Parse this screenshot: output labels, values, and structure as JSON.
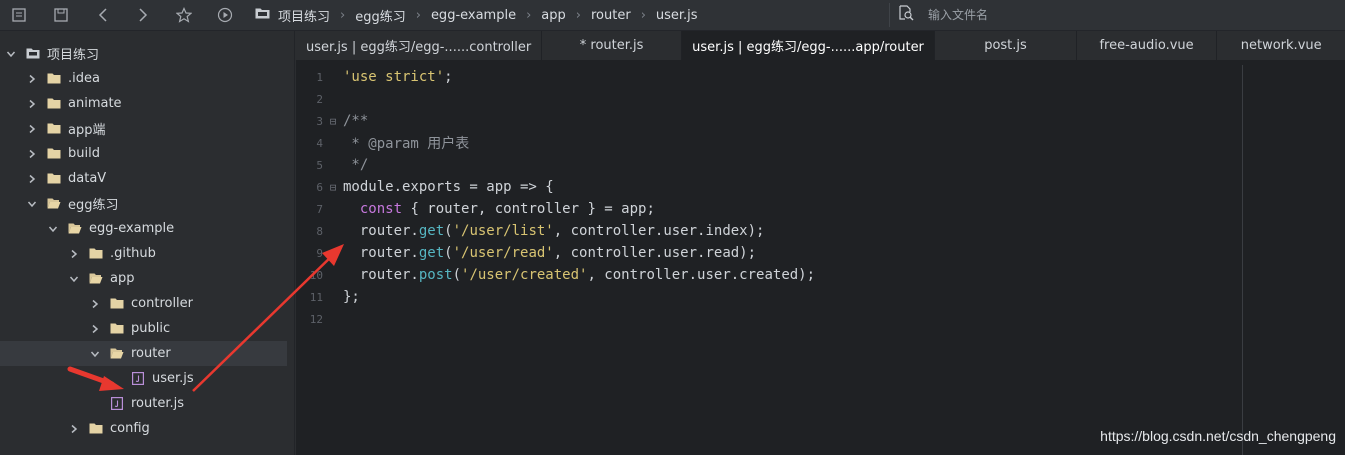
{
  "toolbar": {
    "icons": [
      "sidebar-toggle-icon",
      "save-icon",
      "back-icon",
      "forward-icon",
      "star-icon",
      "run-icon"
    ]
  },
  "breadcrumb": {
    "items": [
      "项目练习",
      "egg练习",
      "egg-example",
      "app",
      "router",
      "user.js"
    ]
  },
  "search": {
    "placeholder": "输入文件名"
  },
  "tree": {
    "items": [
      {
        "label": "项目练习",
        "type": "folder",
        "expanded": true
      },
      {
        "label": ".idea",
        "type": "folder",
        "expanded": false
      },
      {
        "label": "animate",
        "type": "folder",
        "expanded": false
      },
      {
        "label": "app端",
        "type": "folder",
        "expanded": false
      },
      {
        "label": "build",
        "type": "folder",
        "expanded": false
      },
      {
        "label": "dataV",
        "type": "folder",
        "expanded": false
      },
      {
        "label": "egg练习",
        "type": "folder",
        "expanded": true
      },
      {
        "label": "egg-example",
        "type": "folder",
        "expanded": true
      },
      {
        "label": ".github",
        "type": "folder",
        "expanded": false
      },
      {
        "label": "app",
        "type": "folder",
        "expanded": true
      },
      {
        "label": "controller",
        "type": "folder",
        "expanded": false
      },
      {
        "label": "public",
        "type": "folder",
        "expanded": false
      },
      {
        "label": "router",
        "type": "folder",
        "expanded": true
      },
      {
        "label": "user.js",
        "type": "file"
      },
      {
        "label": "router.js",
        "type": "file"
      },
      {
        "label": "config",
        "type": "folder",
        "expanded": false
      }
    ]
  },
  "tabs": [
    {
      "label": "user.js | egg练习/egg-......controller"
    },
    {
      "label": "* router.js"
    },
    {
      "label": "user.js | egg练习/egg-......app/router",
      "active": true
    },
    {
      "label": "post.js"
    },
    {
      "label": "free-audio.vue"
    },
    {
      "label": "network.vue"
    }
  ],
  "editor": {
    "lines": [
      {
        "n": "1",
        "t": [
          [
            "str",
            "'use strict'"
          ],
          [
            "def",
            ";"
          ]
        ]
      },
      {
        "n": "2",
        "t": []
      },
      {
        "n": "3",
        "fold": "⊟",
        "t": [
          [
            "cm",
            "/**"
          ]
        ]
      },
      {
        "n": "4",
        "t": [
          [
            "cm",
            " * @param 用户表"
          ]
        ]
      },
      {
        "n": "5",
        "t": [
          [
            "cm",
            " */"
          ]
        ]
      },
      {
        "n": "6",
        "fold": "⊟",
        "t": [
          [
            "def",
            "module.exports = app => {"
          ]
        ]
      },
      {
        "n": "7",
        "t": [
          [
            "def",
            "  "
          ],
          [
            "kw",
            "const"
          ],
          [
            "def",
            " { router, controller } = app;"
          ]
        ]
      },
      {
        "n": "8",
        "t": [
          [
            "def",
            "  router."
          ],
          [
            "fn",
            "get"
          ],
          [
            "def",
            "("
          ],
          [
            "str",
            "'/user/list'"
          ],
          [
            "def",
            ", controller.user.index);"
          ]
        ]
      },
      {
        "n": "9",
        "t": [
          [
            "def",
            "  router."
          ],
          [
            "fn",
            "get"
          ],
          [
            "def",
            "("
          ],
          [
            "str",
            "'/user/read'"
          ],
          [
            "def",
            ", controller.user.read);"
          ]
        ]
      },
      {
        "n": "10",
        "t": [
          [
            "def",
            "  router."
          ],
          [
            "fn",
            "post"
          ],
          [
            "def",
            "("
          ],
          [
            "str",
            "'/user/created'"
          ],
          [
            "def",
            ", controller.user.created);"
          ]
        ]
      },
      {
        "n": "11",
        "t": [
          [
            "def",
            "};"
          ]
        ]
      },
      {
        "n": "12",
        "t": []
      }
    ]
  },
  "watermark": "https://blog.csdn.net/csdn_chengpeng",
  "colors": {
    "annotation_arrow": "#e8382f",
    "string": "#d8c472",
    "keyword": "#c678dd",
    "method": "#56b6c2",
    "comment": "#8f949b"
  }
}
